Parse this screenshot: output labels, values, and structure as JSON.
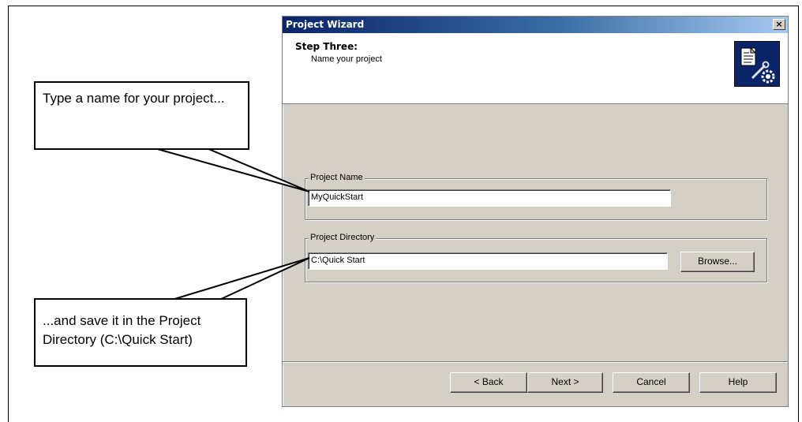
{
  "dialog": {
    "title": "Project Wizard",
    "close_glyph": "×",
    "step_title": "Step Three:",
    "step_subtitle": "Name your project",
    "icon": "wizard-document-gear-icon"
  },
  "project_name": {
    "label": "Project Name",
    "value": "MyQuickStart"
  },
  "project_directory": {
    "label": "Project Directory",
    "value": "C:\\Quick Start",
    "browse_label": "Browse..."
  },
  "buttons": {
    "back": "< Back",
    "next": "Next >",
    "cancel": "Cancel",
    "help": "Help"
  },
  "callouts": {
    "top": "Type a name for your project...",
    "bottom": "...and save it in the Project Directory (C:\\Quick Start)"
  },
  "colors": {
    "title_gradient_start": "#0a246a",
    "title_gradient_end": "#a6caf0",
    "dialog_face": "#d4d0c8"
  }
}
